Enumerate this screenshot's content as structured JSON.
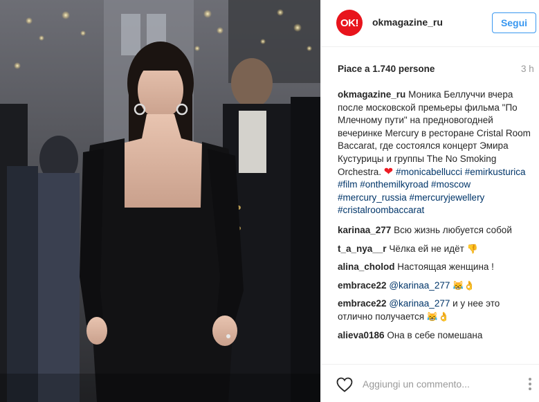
{
  "account": {
    "avatar_text": "OK!",
    "username": "okmagazine_ru",
    "follow_label": "Segui"
  },
  "post": {
    "likes": "Piace a 1.740 persone",
    "time_ago": "3 h"
  },
  "caption": {
    "user": "okmagazine_ru",
    "text": "Моника Беллуччи вчера после московской премьеры фильма \"По Млечному пути\" на предновогодней вечеринке Mercury в ресторане Cristal Room Baccarat, где состоялся концерт Эмира Кустурицы и группы The No Smoking Orchestra.",
    "heart": "❤",
    "hashtags": "#monicabellucci #emirkusturica #film #onthemilkyroad #moscow #mercury_russia #mercuryjewellery #cristalroombaccarat"
  },
  "comments": [
    {
      "user": "karinaa_277",
      "mention": "",
      "text": "Всю жизнь любуется собой",
      "emoji": ""
    },
    {
      "user": "t_a_nya__r",
      "mention": "",
      "text": "Чёлка ей не идёт",
      "emoji": "👎"
    },
    {
      "user": "alina_cholod",
      "mention": "",
      "text": "Настоящая женщина !",
      "emoji": ""
    },
    {
      "user": "embrace22",
      "mention": "@karinaa_277",
      "text": "",
      "emoji": "😹👌"
    },
    {
      "user": "embrace22",
      "mention": "@karinaa_277",
      "text": "и у нее это отлично получается",
      "emoji": "😹👌"
    },
    {
      "user": "alieva0186",
      "mention": "",
      "text": "Она в себе помешана",
      "emoji": ""
    }
  ],
  "comment_box": {
    "placeholder": "Aggiungi un commento..."
  },
  "icons": {
    "like": "heart-outline-icon",
    "more": "more-options-icon"
  },
  "colors": {
    "accent": "#3897f0",
    "brand": "#e8141c",
    "hashtag": "#003569"
  }
}
